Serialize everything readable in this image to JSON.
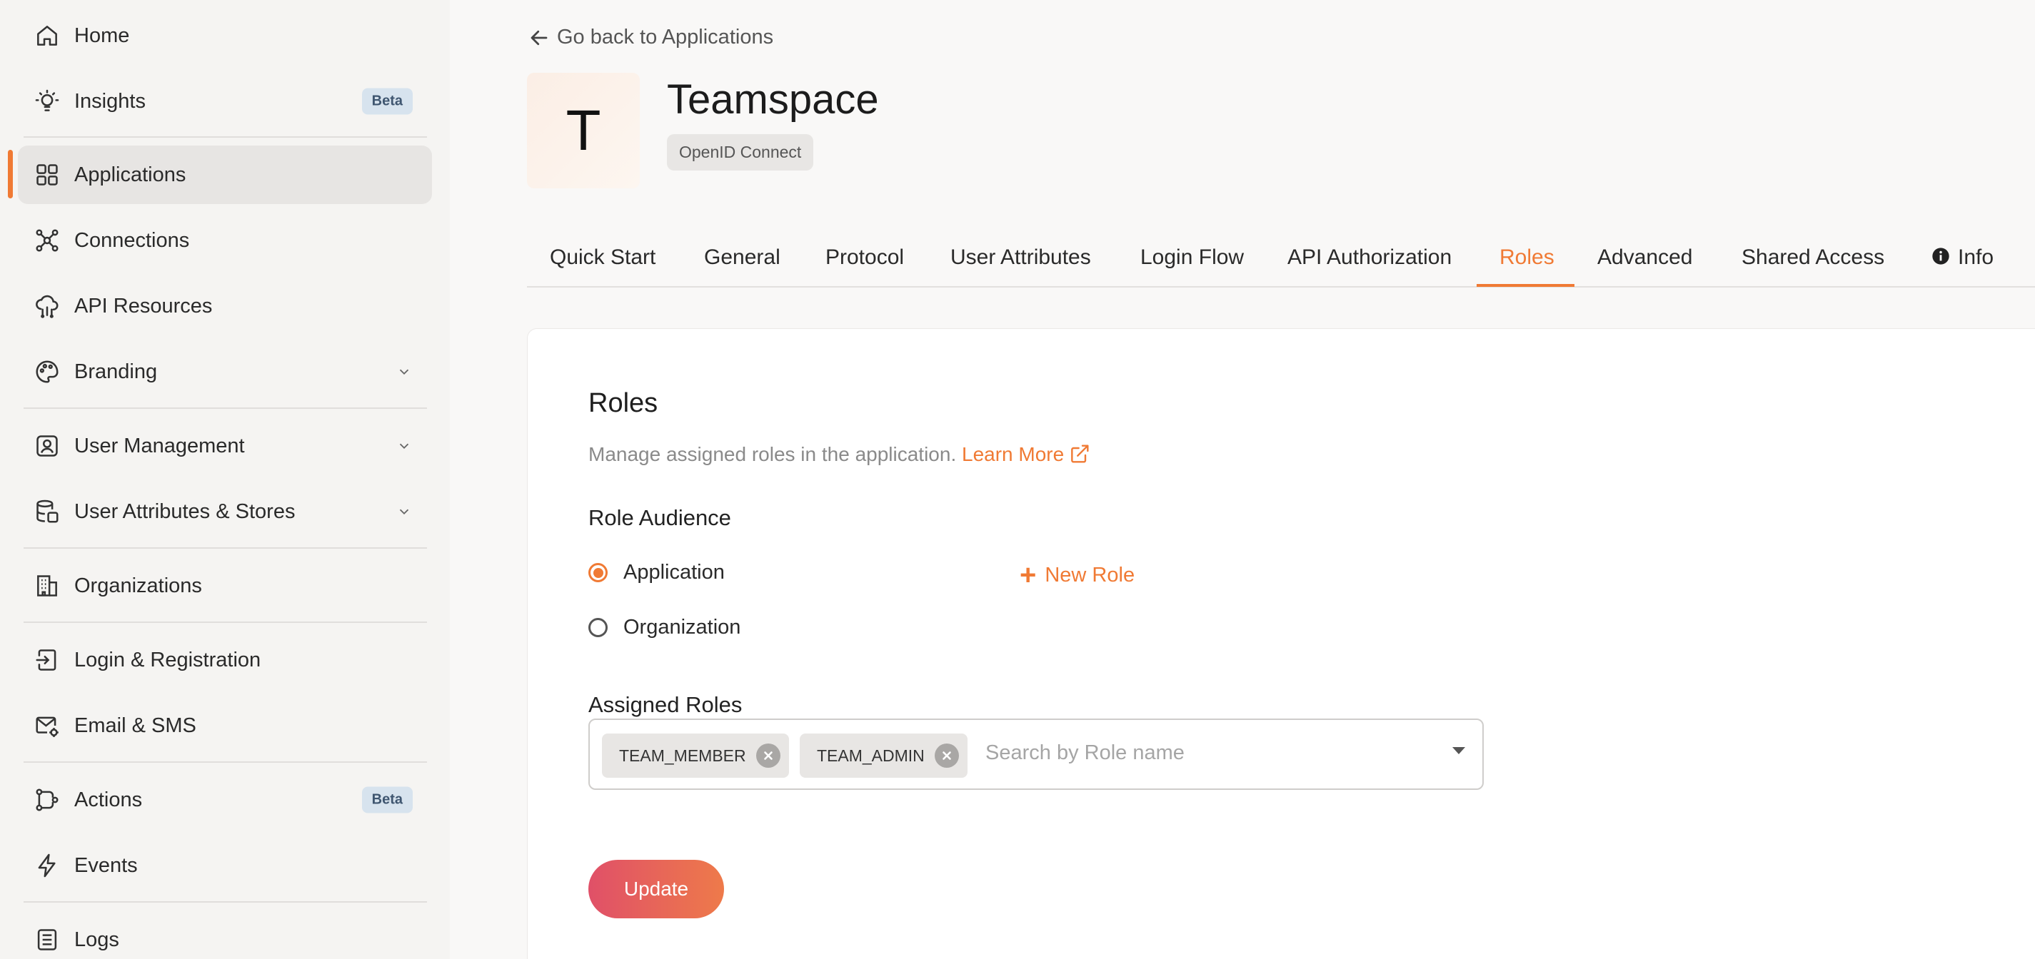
{
  "sidebar": {
    "items": [
      {
        "label": "Home",
        "icon": "home-icon"
      },
      {
        "label": "Insights",
        "icon": "bulb-icon",
        "badge": "Beta"
      },
      {
        "label": "Applications",
        "icon": "grid-icon",
        "active": true
      },
      {
        "label": "Connections",
        "icon": "connections-icon"
      },
      {
        "label": "API Resources",
        "icon": "cloud-api-icon"
      },
      {
        "label": "Branding",
        "icon": "palette-icon",
        "expandable": true
      },
      {
        "label": "User Management",
        "icon": "user-card-icon",
        "expandable": true
      },
      {
        "label": "User Attributes & Stores",
        "icon": "database-icon",
        "expandable": true
      },
      {
        "label": "Organizations",
        "icon": "building-icon"
      },
      {
        "label": "Login & Registration",
        "icon": "login-flow-icon"
      },
      {
        "label": "Email & SMS",
        "icon": "mail-gear-icon"
      },
      {
        "label": "Actions",
        "icon": "workflow-icon",
        "badge": "Beta"
      },
      {
        "label": "Events",
        "icon": "lightning-icon"
      },
      {
        "label": "Logs",
        "icon": "logs-icon"
      }
    ],
    "accent_color": "#f07a34"
  },
  "header": {
    "back_label": "Go back to Applications",
    "app_initial": "T",
    "app_name": "Teamspace",
    "protocol_chip": "OpenID Connect"
  },
  "tabs": [
    {
      "label": "Quick Start"
    },
    {
      "label": "General"
    },
    {
      "label": "Protocol"
    },
    {
      "label": "User Attributes"
    },
    {
      "label": "Login Flow"
    },
    {
      "label": "API Authorization"
    },
    {
      "label": "Roles",
      "active": true
    },
    {
      "label": "Advanced"
    },
    {
      "label": "Shared Access"
    },
    {
      "label": "Info",
      "icon": "info-icon"
    }
  ],
  "roles": {
    "title": "Roles",
    "description": "Manage assigned roles in the application.",
    "learn_more": "Learn More",
    "audience_label": "Role Audience",
    "audience_options": [
      {
        "label": "Application",
        "checked": true
      },
      {
        "label": "Organization",
        "checked": false
      }
    ],
    "new_role_label": "New Role",
    "assigned_label": "Assigned Roles",
    "assigned_roles": [
      "TEAM_MEMBER",
      "TEAM_ADMIN"
    ],
    "search_placeholder": "Search by Role name",
    "update_label": "Update"
  }
}
